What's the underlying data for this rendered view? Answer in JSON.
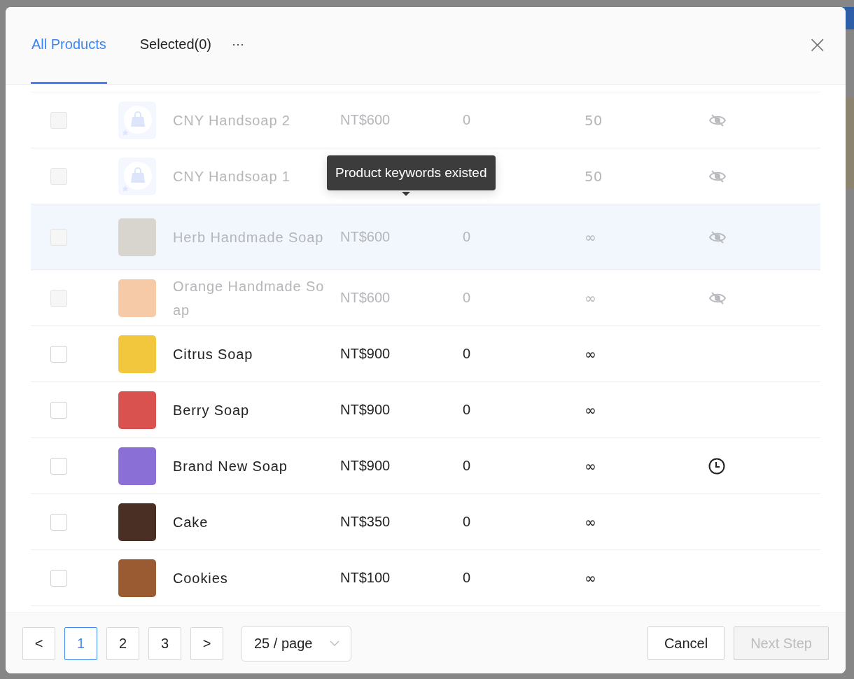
{
  "dialog": {
    "tabs": [
      {
        "label": "All Products",
        "selected": true
      },
      {
        "label": "Selected(0)",
        "selected": false
      }
    ],
    "more": "···",
    "close": "×"
  },
  "rows": [
    {
      "checked": false,
      "disabled": true,
      "highlighted": false,
      "placeholder_image": true,
      "name": "CNY Handsoap 2",
      "price": "NT$600",
      "column_3": "0",
      "column_4": "50",
      "hidden": true,
      "scheduled": false
    },
    {
      "checked": false,
      "disabled": true,
      "highlighted": false,
      "placeholder_image": true,
      "name": "CNY Handsoap 1",
      "column_4": "50",
      "hidden": true,
      "scheduled": false
    },
    {
      "checked": false,
      "disabled": true,
      "highlighted": true,
      "placeholder_image": false,
      "name": "Herb Handmade Soap",
      "price": "NT$600",
      "column_3": "0",
      "column_4": "∞",
      "hidden": true,
      "scheduled": false
    },
    {
      "checked": false,
      "disabled": true,
      "highlighted": false,
      "placeholder_image": false,
      "name": "Orange Handmade Soap",
      "price": "NT$600",
      "column_3": "0",
      "column_4": "∞",
      "hidden": true,
      "scheduled": false
    },
    {
      "checked": false,
      "disabled": false,
      "highlighted": false,
      "placeholder_image": false,
      "name": "Citrus Soap",
      "price": "NT$900",
      "column_3": "0",
      "column_4": "∞",
      "hidden": false,
      "scheduled": false
    },
    {
      "checked": false,
      "disabled": false,
      "highlighted": false,
      "placeholder_image": false,
      "name": "Berry Soap",
      "price": "NT$900",
      "column_3": "0",
      "column_4": "∞",
      "hidden": false,
      "scheduled": false
    },
    {
      "checked": false,
      "disabled": false,
      "highlighted": false,
      "placeholder_image": false,
      "name": "Brand New Soap",
      "price": "NT$900",
      "column_3": "0",
      "column_4": "∞",
      "hidden": false,
      "scheduled": true
    },
    {
      "checked": false,
      "disabled": false,
      "highlighted": false,
      "placeholder_image": false,
      "name": "Cake",
      "price": "NT$350",
      "column_3": "0",
      "column_4": "∞",
      "hidden": false,
      "scheduled": false
    },
    {
      "checked": false,
      "disabled": false,
      "highlighted": false,
      "placeholder_image": false,
      "name": "Cookies",
      "price": "NT$100",
      "column_3": "0",
      "column_4": "∞",
      "hidden": false,
      "scheduled": false
    }
  ],
  "tooltip": "Product keywords existed",
  "pagination": {
    "prev": "<",
    "pages": [
      {
        "label": "1",
        "selected": true
      },
      {
        "label": "2",
        "selected": false
      },
      {
        "label": "3",
        "selected": false
      }
    ],
    "next": ">",
    "page_size": "25 / page"
  },
  "buttons": [
    {
      "label": "Cancel",
      "disabled": false
    },
    {
      "label": "Next Step",
      "disabled": true
    }
  ]
}
